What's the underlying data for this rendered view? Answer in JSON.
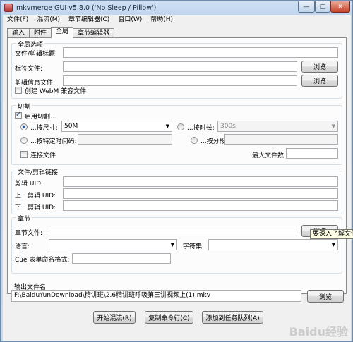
{
  "window": {
    "title": "mkvmerge GUI v5.8.0 ('No Sleep / Pillow')",
    "minimize": "—",
    "maximize": "□",
    "close": "✕"
  },
  "menu": [
    "文件(F)",
    "混流(M)",
    "章节编辑器(C)",
    "窗口(W)",
    "帮助(H)"
  ],
  "tabs": [
    "输入",
    "附件",
    "全局",
    "章节编辑器"
  ],
  "global": {
    "legend": "全局选项",
    "file_title_label": "文件/剪辑标题:",
    "tags_label": "标签文件:",
    "segment_info_label": "剪辑信息文件:",
    "webm_label": "创建 WebM 兼容文件",
    "browse": "浏览"
  },
  "split": {
    "legend": "切割",
    "enable_label": "启用切割...",
    "by_size_label": "...按尺寸:",
    "by_size_value": "50M",
    "by_duration_label": "...按时长:",
    "by_duration_value": "300s",
    "by_timecodes_label": "...按特定时间码:",
    "by_parts_label": "...按分段:",
    "link_label": "连接文件",
    "max_files_label": "最大文件数:"
  },
  "linking": {
    "legend": "文件/剪辑链接",
    "segment_uid_label": "剪辑 UID:",
    "prev_uid_label": "上一剪辑 UID:",
    "next_uid_label": "下一剪辑 UID:"
  },
  "chapters": {
    "legend": "章节",
    "file_label": "章节文件:",
    "language_label": "语言:",
    "charset_label": "字符集:",
    "cue_label": "Cue 表单命名格式:",
    "browse": "浏览"
  },
  "tooltip": "要深入了解文件",
  "output": {
    "legend": "输出文件名",
    "path": "F:\\BaiduYunDownload\\精讲班\\2.6精讲班呼吸第三讲视频上(1).mkv",
    "browse": "浏览"
  },
  "actions": {
    "start": "开始混流(R)",
    "copy": "复制命令行(C)",
    "add_job": "添加到任务队列(A)"
  },
  "watermark": "Baidu经验"
}
